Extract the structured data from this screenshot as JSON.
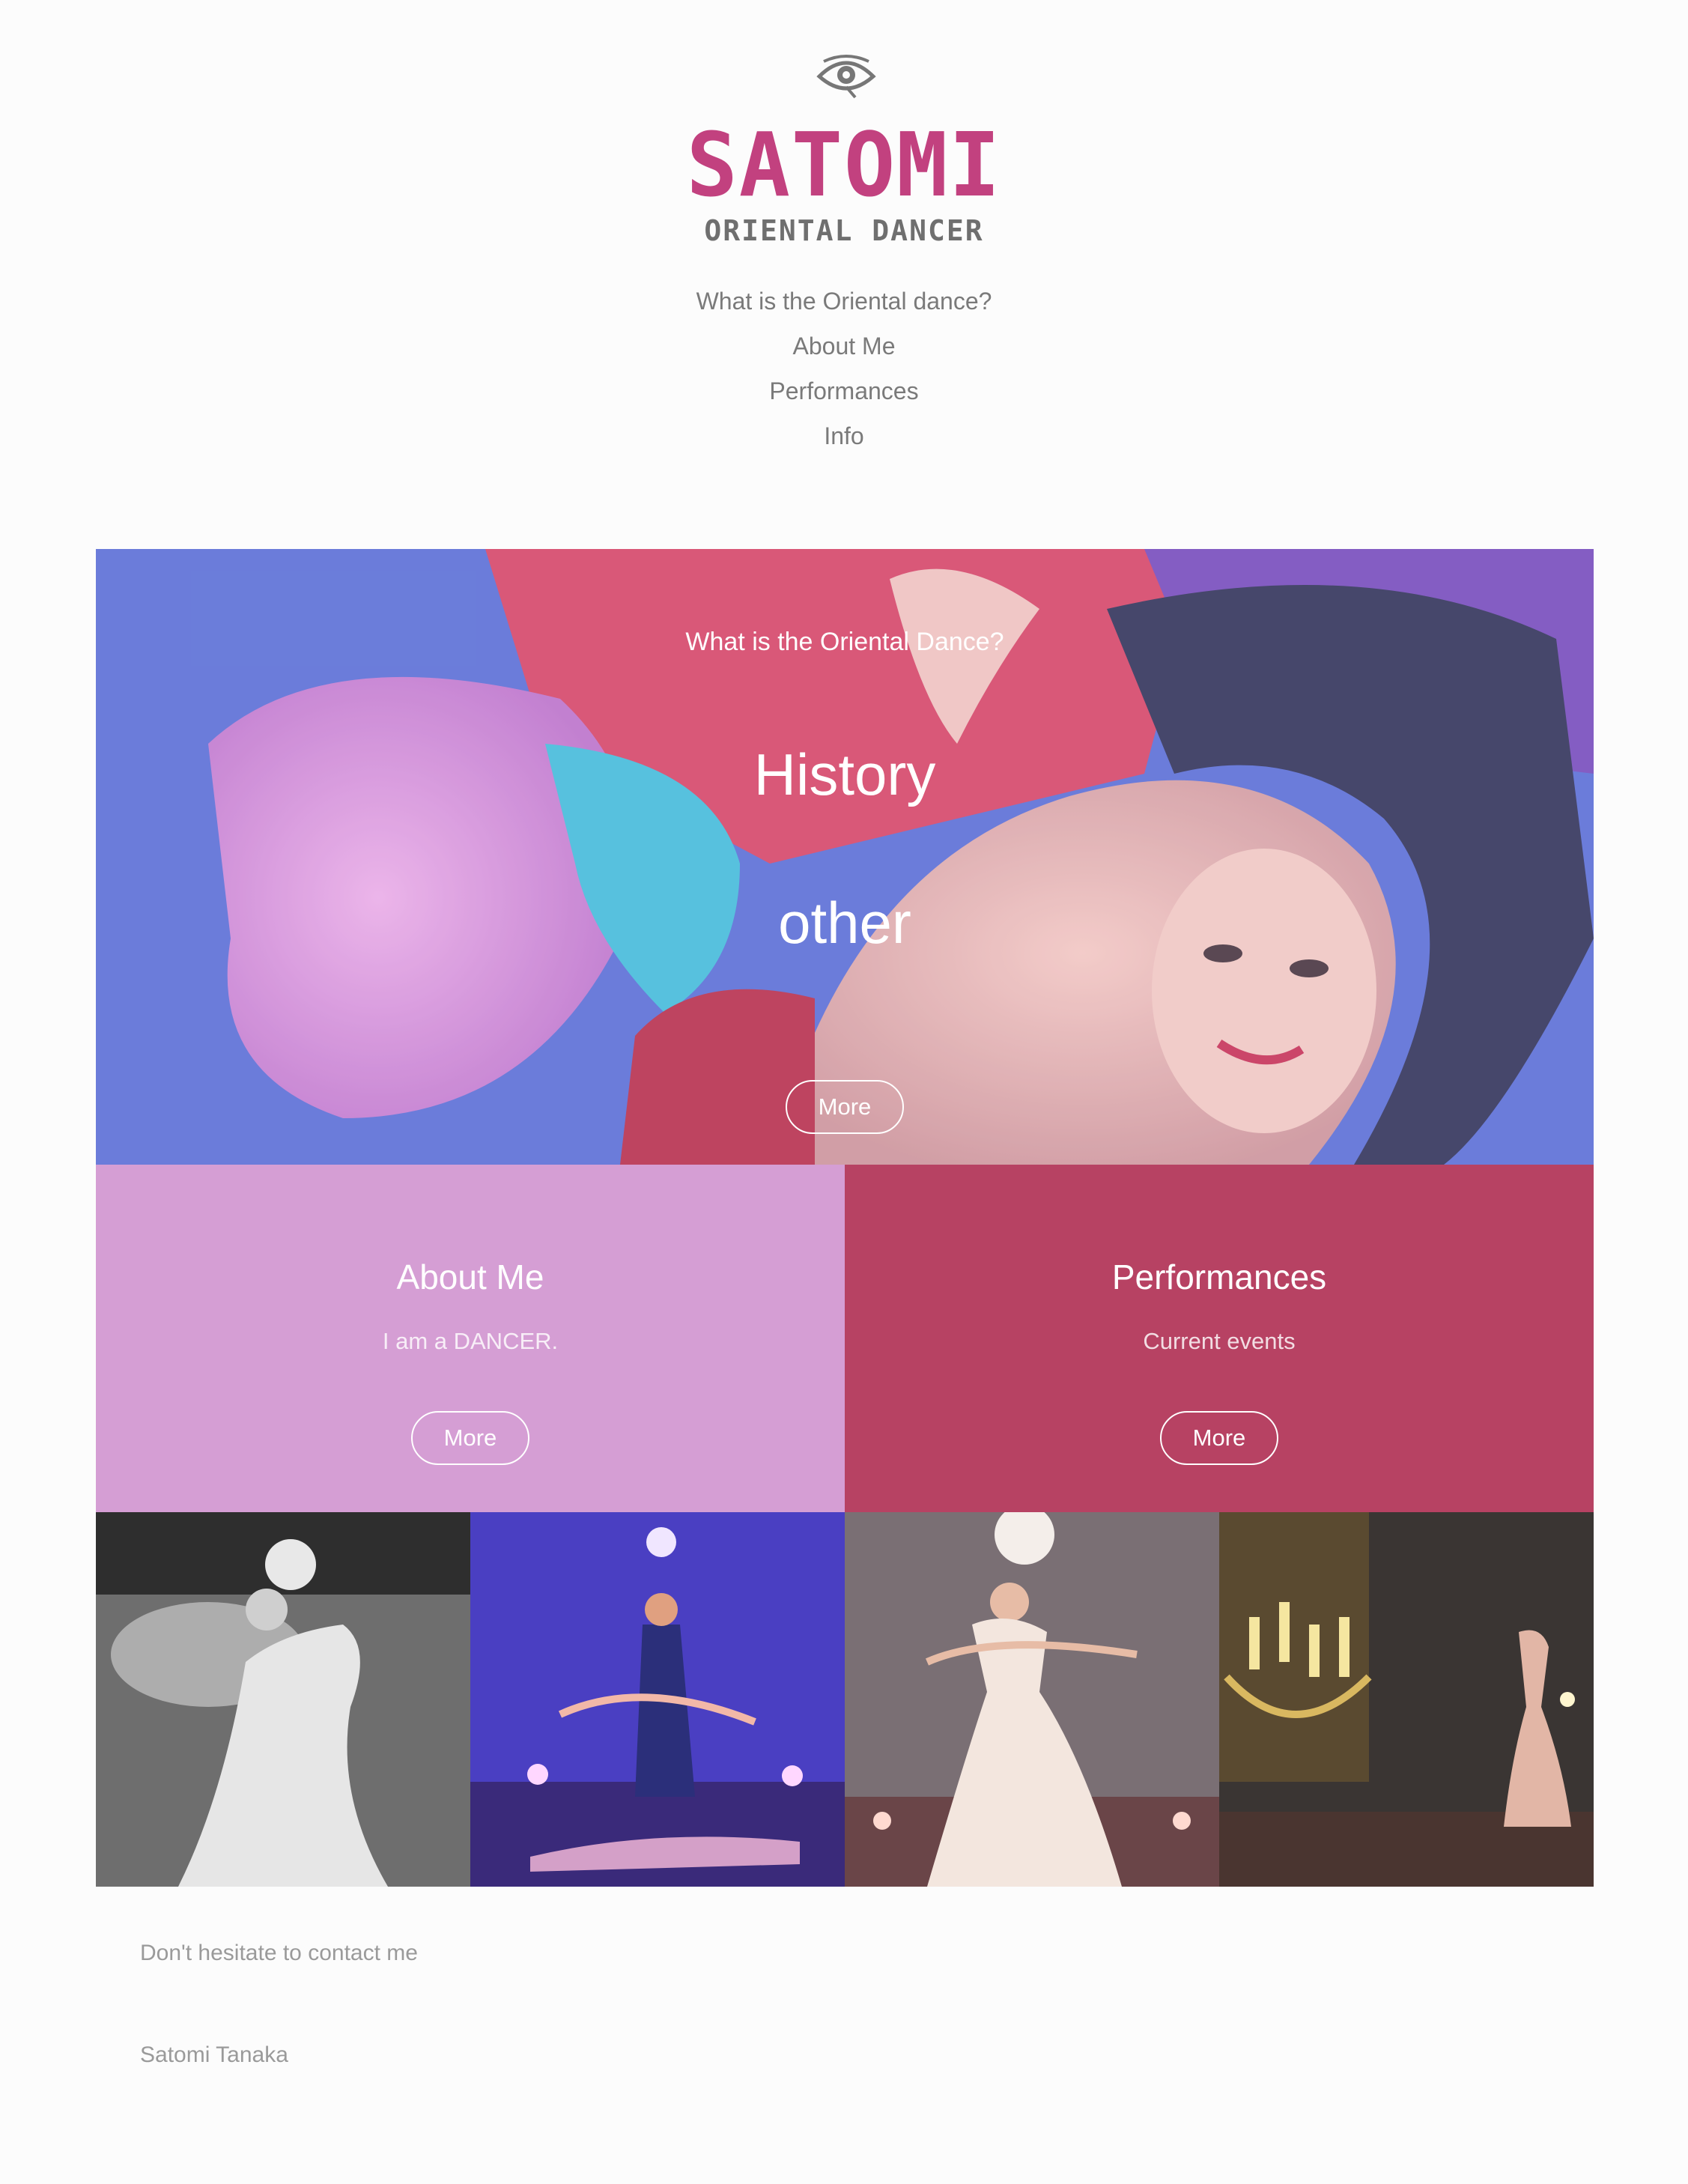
{
  "header": {
    "logo_title": "SATOMI",
    "logo_subtitle": "ORIENTAL DANCER",
    "brand_color": "#c2417f",
    "icon": "eye-icon"
  },
  "nav": {
    "items": [
      {
        "label": "What is the Oriental dance?"
      },
      {
        "label": "About Me"
      },
      {
        "label": "Performances"
      },
      {
        "label": "Info"
      }
    ]
  },
  "hero": {
    "eyebrow": "What is the Oriental Dance?",
    "line1": "History",
    "line2": "other",
    "button_label": "More"
  },
  "tiles": {
    "about": {
      "title": "About Me",
      "subtitle": "I am a DANCER.",
      "button_label": "More",
      "color": "#d59ed4"
    },
    "performances": {
      "title": "Performances",
      "subtitle": "Current events",
      "button_label": "More",
      "color": "#b74263"
    }
  },
  "footer": {
    "contact_text": "Don't hesitate to contact me",
    "owner_name": "Satomi Tanaka"
  }
}
